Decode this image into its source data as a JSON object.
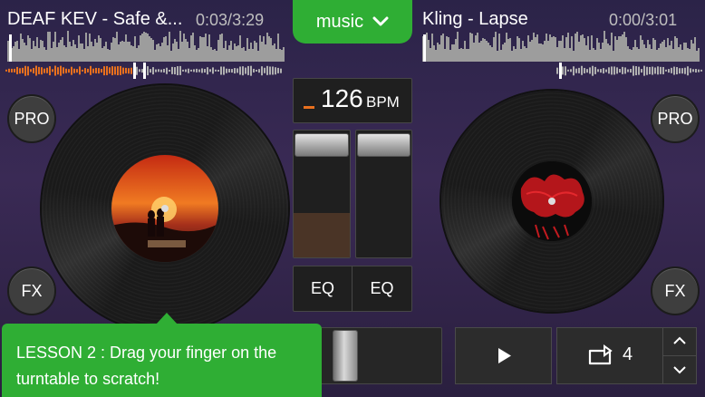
{
  "deck_left": {
    "title": "DEAF KEV - Safe &...",
    "elapsed": "0:03",
    "duration": "3:29",
    "progress": 0.015,
    "pro_label": "PRO",
    "fx_label": "FX",
    "eq_label": "EQ"
  },
  "deck_right": {
    "title": "Kling - Lapse",
    "elapsed": "0:00",
    "duration": "3:01",
    "progress": 0.0,
    "pro_label": "PRO",
    "fx_label": "FX",
    "eq_label": "EQ"
  },
  "center": {
    "music_tab_label": "music",
    "bpm_value": "126",
    "bpm_unit": "BPM",
    "left_volume_level": 0.35,
    "right_volume_level": 0.0,
    "crossfader_position": 0.2
  },
  "transport": {
    "loop_count": "4"
  },
  "lesson": {
    "text": "LESSON 2 : Drag your finger on the turntable to scratch!"
  },
  "colors": {
    "accent_green": "#2fae34",
    "waveform_played": "#e8701e",
    "background": "#2b2348"
  }
}
